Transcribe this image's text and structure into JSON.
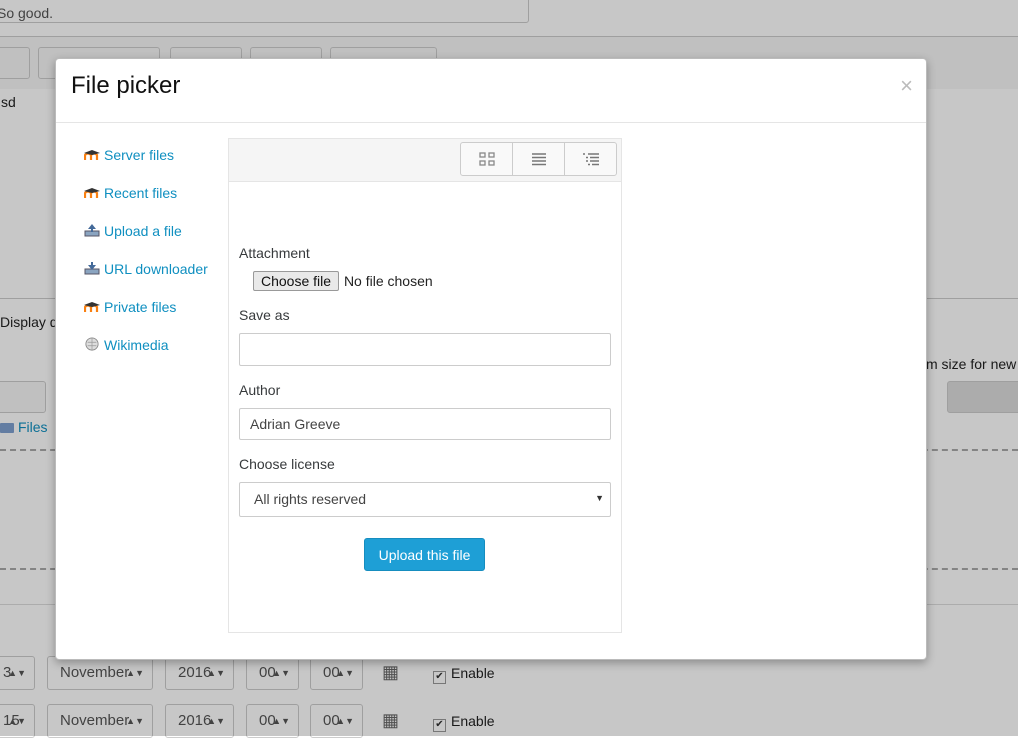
{
  "background": {
    "comment_text": "So good.",
    "editor_text": "sd",
    "display_label": "Display d",
    "max_size_label": "m size for new",
    "files_label": "Files",
    "date_rows": [
      {
        "day": "3",
        "month": "November",
        "year": "2016",
        "hour": "00",
        "minute": "00",
        "enable_label": "Enable",
        "enabled": true
      },
      {
        "day": "15",
        "month": "November",
        "year": "2016",
        "hour": "00",
        "minute": "00",
        "enable_label": "Enable",
        "enabled": true
      }
    ]
  },
  "modal": {
    "title": "File picker",
    "close_symbol": "×",
    "repositories": [
      {
        "label": "Server files",
        "icon": "moodle-icon"
      },
      {
        "label": "Recent files",
        "icon": "moodle-icon"
      },
      {
        "label": "Upload a file",
        "icon": "upload-icon"
      },
      {
        "label": "URL downloader",
        "icon": "download-icon"
      },
      {
        "label": "Private files",
        "icon": "moodle-icon"
      },
      {
        "label": "Wikimedia",
        "icon": "wikipedia-icon"
      }
    ],
    "view_buttons": [
      "grid-view-icon",
      "list-view-icon",
      "tree-view-icon"
    ],
    "form": {
      "attachment_label": "Attachment",
      "choose_file_label": "Choose file",
      "no_file_text": "No file chosen",
      "save_as_label": "Save as",
      "save_as_value": "",
      "author_label": "Author",
      "author_value": "Adrian Greeve",
      "license_label": "Choose license",
      "license_value": "All rights reserved",
      "upload_button": "Upload this file"
    }
  },
  "colors": {
    "link": "#0f8fc0",
    "primary_button": "#1e9fd6",
    "overlay": "rgba(0,0,0,0.22)"
  }
}
